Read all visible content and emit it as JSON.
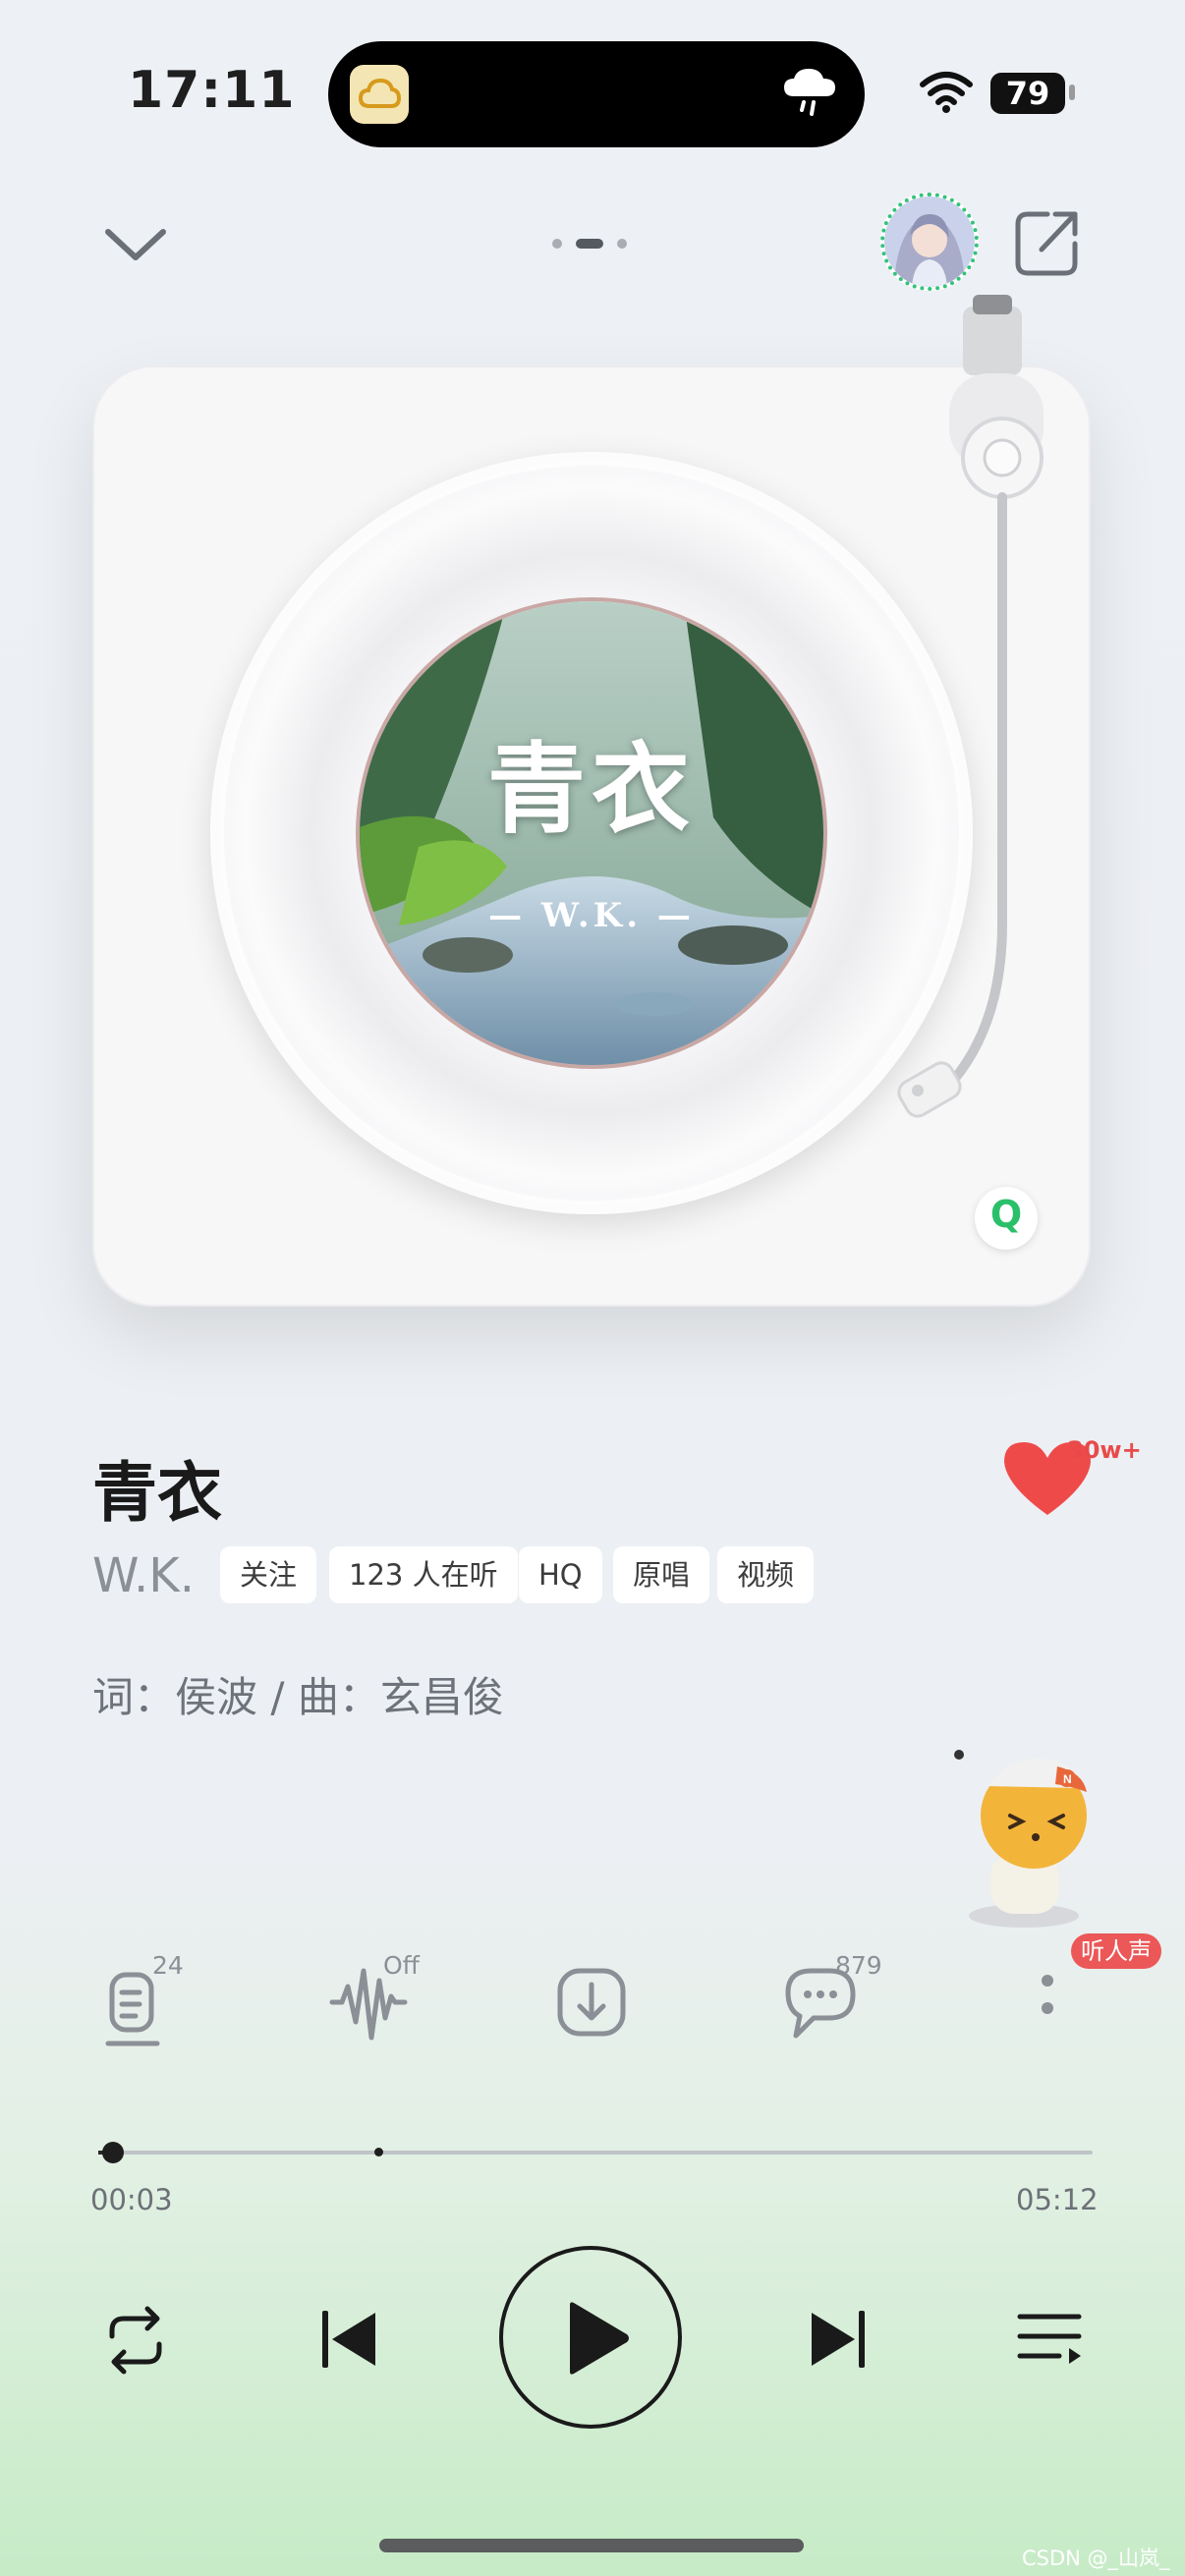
{
  "status": {
    "time": "17:11",
    "battery": "79"
  },
  "song": {
    "title": "青衣",
    "artist": "W.K.",
    "credits": "词：侯波 / 曲：玄昌俊",
    "likes": "30w+",
    "cover_title": "青衣",
    "cover_artist": "— W.K. —"
  },
  "tags": [
    "关注",
    "123 人在听",
    "HQ",
    "原唱",
    "视频"
  ],
  "mascot_badge": "听人声",
  "actions": {
    "lyrics_count": "24",
    "effect_state": "Off",
    "comment_count": "879"
  },
  "progress": {
    "current": "00:03",
    "total": "05:12",
    "fraction": 0.01
  },
  "watermark": "CSDN @_山岚_",
  "colors": {
    "like": "#e84a4a",
    "accent_green": "#2ac06a",
    "badge_red": "#ec5757"
  }
}
